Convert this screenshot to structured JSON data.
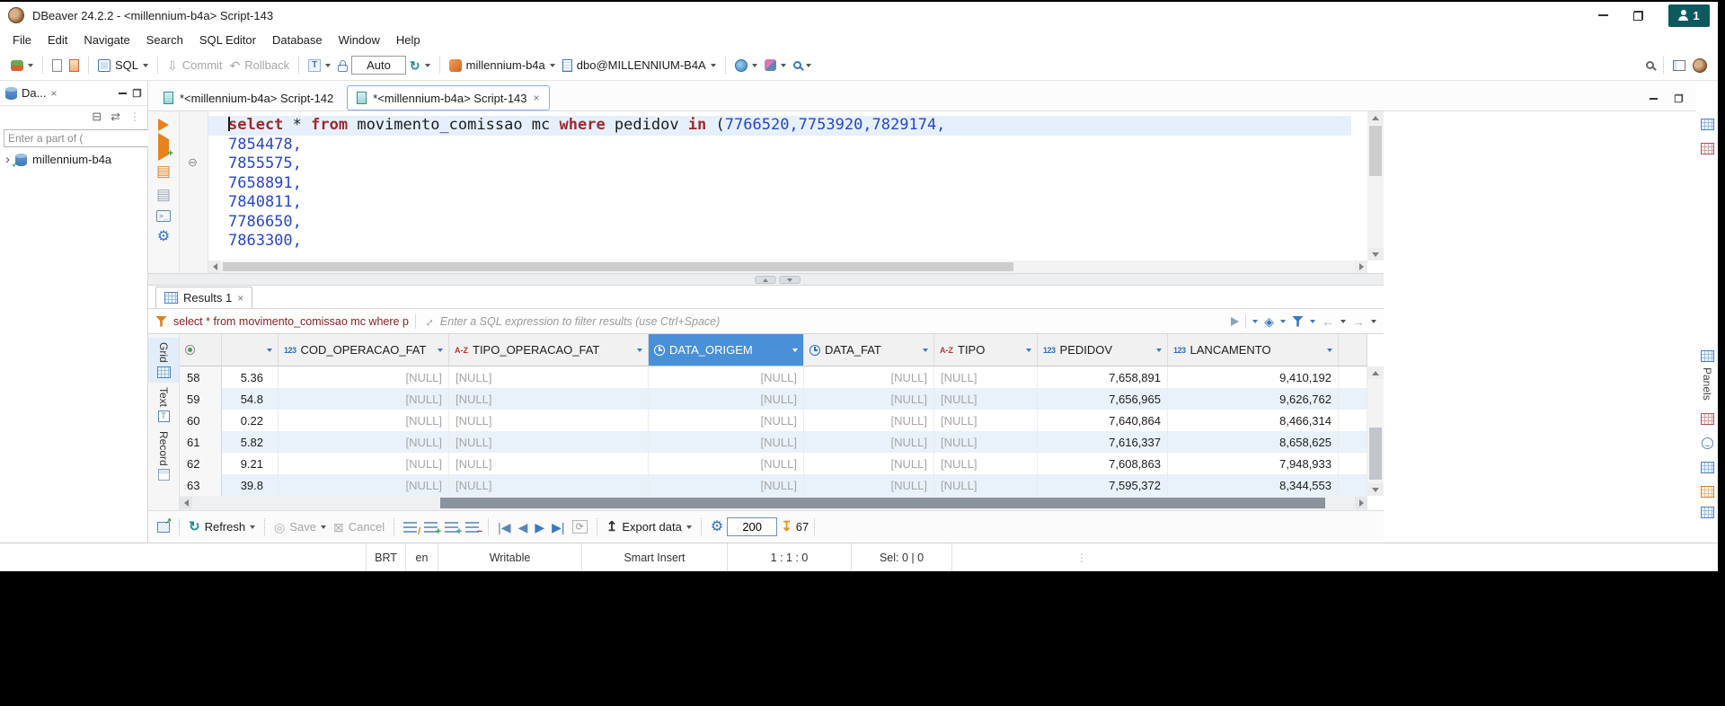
{
  "window": {
    "title": "DBeaver 24.2.2 - <millennium-b4a>  Script-143",
    "badge_count": "1"
  },
  "menubar": {
    "items": [
      "File",
      "Edit",
      "Navigate",
      "Search",
      "SQL Editor",
      "Database",
      "Window",
      "Help"
    ]
  },
  "toolbar": {
    "sql": "SQL",
    "commit": "Commit",
    "rollback": "Rollback",
    "auto": "Auto",
    "connection": "millennium-b4a",
    "database": "dbo@MILLENNIUM-B4A"
  },
  "sidebar": {
    "tab": "Da...",
    "filter_value": "Enter a part of (",
    "tree_item": "millennium-b4a"
  },
  "editor": {
    "tabs": [
      {
        "label": "*<millennium-b4a> Script-142"
      },
      {
        "label": "*<millennium-b4a> Script-143"
      }
    ],
    "code": {
      "line1": {
        "kw1": "select",
        "t1": " * ",
        "kw2": "from",
        "t2": " movimento_comissao mc ",
        "kw3": "where",
        "t3": " pedidov ",
        "kw4": "in",
        "t4": " (",
        "num": "7766520,7753920,7829174,"
      },
      "lines": [
        "7854478,",
        "7855575,",
        "7658891,",
        "7840811,",
        "7786650,",
        "7863300,"
      ]
    }
  },
  "results": {
    "tab": "Results 1",
    "filter_text": "select * from movimento_comissao mc where p",
    "filter_placeholder": "Enter a SQL expression to filter results (use Ctrl+Space)",
    "side_tabs": {
      "grid": "Grid",
      "text": "Text",
      "record": "Record"
    },
    "panels": "Panels"
  },
  "grid": {
    "header": {
      "icon_num": "123",
      "icon_az": "A-Z",
      "c2": "COD_OPERACAO_FAT",
      "c3": "TIPO_OPERACAO_FAT",
      "c4": "DATA_ORIGEM",
      "c5": "DATA_FAT",
      "c6": "TIPO",
      "c7": "PEDIDOV",
      "c8": "LANCAMENTO"
    },
    "null_text": "[NULL]",
    "rows": [
      {
        "num": "58",
        "v": "5.36",
        "pedidov": "7,658,891",
        "lanc": "9,410,192"
      },
      {
        "num": "59",
        "v": "54.8",
        "pedidov": "7,656,965",
        "lanc": "9,626,762"
      },
      {
        "num": "60",
        "v": "0.22",
        "pedidov": "7,640,864",
        "lanc": "8,466,314"
      },
      {
        "num": "61",
        "v": "5.82",
        "pedidov": "7,616,337",
        "lanc": "8,658,625"
      },
      {
        "num": "62",
        "v": "9.21",
        "pedidov": "7,608,863",
        "lanc": "7,948,933"
      },
      {
        "num": "63",
        "v": "39.8",
        "pedidov": "7,595,372",
        "lanc": "8,344,553"
      }
    ]
  },
  "res_toolbar": {
    "refresh": "Refresh",
    "save": "Save",
    "cancel": "Cancel",
    "export": "Export data",
    "fetch_size": "200",
    "count": "67"
  },
  "statusbar": {
    "timezone": "BRT",
    "lang": "en",
    "writable": "Writable",
    "insert_mode": "Smart Insert",
    "caret": "1 : 1 : 0",
    "selection": "Sel: 0 | 0"
  }
}
